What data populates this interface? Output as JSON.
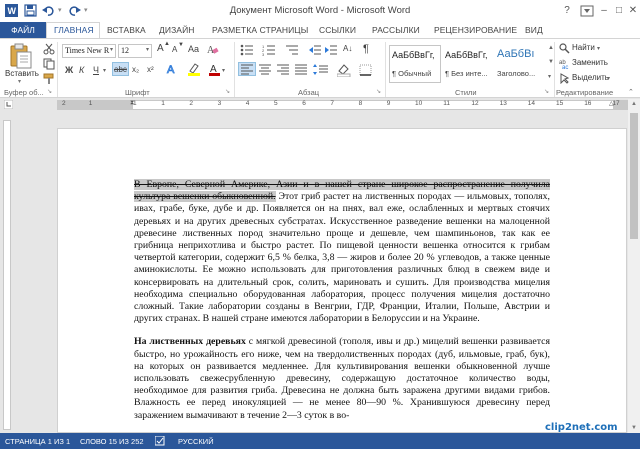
{
  "window": {
    "title": "Документ Microsoft Word - Microsoft Word",
    "controls": {
      "help": "?",
      "minimize": "–",
      "maximize": "□",
      "close": "✕"
    }
  },
  "ribbon_tabs": {
    "file": "ФАЙЛ",
    "home": "ГЛАВНАЯ",
    "insert": "ВСТАВКА",
    "design": "ДИЗАЙН",
    "layout": "РАЗМЕТКА СТРАНИЦЫ",
    "references": "ССЫЛКИ",
    "mailings": "РАССЫЛКИ",
    "review": "РЕЦЕНЗИРОВАНИЕ",
    "view": "ВИД"
  },
  "clipboard": {
    "paste_label": "Вставить",
    "group_label": "Буфер об..."
  },
  "font": {
    "name": "Times New R",
    "size": "12",
    "grow": "A",
    "shrink": "A",
    "case": "Aa",
    "bold": "Ж",
    "italic": "К",
    "underline": "Ч",
    "strike": "abc",
    "subscript": "x₂",
    "superscript": "x²",
    "group_label": "Шрифт"
  },
  "paragraph": {
    "sort": "A↓",
    "pilcrow": "¶",
    "group_label": "Абзац"
  },
  "styles": {
    "items": [
      {
        "sample": "АаБбВвГг,",
        "name": "¶ Обычный"
      },
      {
        "sample": "АаБбВвГг,",
        "name": "¶ Без инте..."
      },
      {
        "sample": "АаБбВı",
        "name": "Заголово..."
      }
    ],
    "group_label": "Стили"
  },
  "editing": {
    "find": "Найти",
    "replace": "Заменить",
    "select": "Выделить",
    "group_label": "Редактирование"
  },
  "ruler": {
    "numbers": [
      "1",
      "2",
      "1",
      "1",
      "2",
      "3",
      "4",
      "5",
      "6",
      "7",
      "8",
      "9",
      "10",
      "11",
      "12",
      "13",
      "14",
      "15",
      "16",
      "17"
    ]
  },
  "document": {
    "para1_struck": "В Европе, Северной Америке, Азии и в нашей стране широкое распространение получила культура вешенки обыкновенной.",
    "para1_rest": " Этот гриб растет на лиственных породах — ильмовых, тополях, ивах, грабе, буке, дубе и др. Появляется он на пнях, вал еже, ослабленных и мертвых стоячих деревьях и на других древесных субстратах. Искусственное разведение вешенки на малоценной древесине лиственных пород значительно проще и дешевле, чем шампиньонов, так как ее грибница неприхотлива и быстро растет. По пищевой ценности вешенка относится к грибам четвертой категории, содержит 6,5 % белка, 3,8 — жиров и более 20 % углеводов, а также ценные аминокислоты. Ее можно использовать для приготовления различных блюд в свежем виде и консервировать на длительный срок, солить, мариновать и сушить. Для производства мицелия необходима специально оборудованная лаборатория, процесс получения мицелия достаточно сложный. Такие лаборатории созданы в Венгрии, ГДР, Франции, Италии, Польше, Австрии и других странах. В нашей стране имеются лаборатории в Белоруссии и на Украине.",
    "para2_bold": "На лиственных деревьях",
    "para2_rest": " с мягкой древесиной (тополя, ивы и др.) мицелий вешенки развивается быстро, но урожайность его ниже, чем на твердолиственных породах (дуб, ильмовые, граб, бук), на которых он развивается медленнее. Для культивирования вешенки обыкновенной лучше использовать свежесрубленную древесину, содержащую достаточное количество воды, необходимое для развития гриба. Древесина не должна быть заражена другими видами грибов. Влажность ее перед инокуляцией — не менее 80—90 %. Хранившуюся древесину перед заражением вымачивают в течение 2—3 суток в во-"
  },
  "status_bar": {
    "page": "СТРАНИЦА 1 ИЗ 1",
    "words": "СЛОВО 15 ИЗ 252",
    "language": "РУССКИЙ"
  },
  "watermark": "clip2net.com",
  "colors": {
    "accent": "#2b579a",
    "highlight": "#c8c8c8",
    "font_color": "#c00000",
    "highlight_color": "#ffff00"
  }
}
